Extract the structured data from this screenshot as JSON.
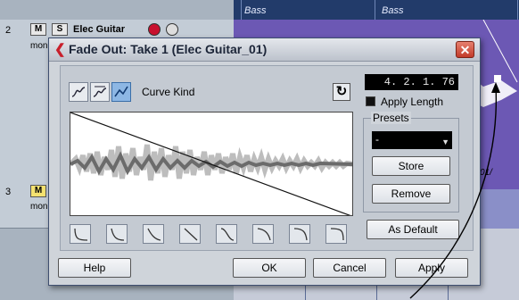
{
  "background": {
    "ruler_labels": [
      "Bass",
      "Bass"
    ],
    "tracks": [
      {
        "number": "2",
        "mute": "M",
        "solo": "S",
        "name": "Elec Guitar",
        "mode": "mon"
      },
      {
        "number": "3",
        "mute": "M",
        "mode": "mon"
      }
    ],
    "clip_time": "01/"
  },
  "dialog": {
    "title": "Fade Out: Take 1 (Elec Guitar_01)",
    "close_glyph": "✕",
    "curve_kind_label": "Curve Kind",
    "reset_glyph": "↻",
    "length_value": "4. 2. 1. 76",
    "apply_length_label": "Apply Length",
    "apply_length_checked": true,
    "presets": {
      "group_label": "Presets",
      "selected": "-",
      "store_label": "Store",
      "remove_label": "Remove"
    },
    "as_default_label": "As Default",
    "buttons": {
      "help": "Help",
      "ok": "OK",
      "cancel": "Cancel",
      "apply": "Apply"
    },
    "curve_kind_icons": [
      "spline-curve-icon",
      "damped-spline-curve-icon",
      "linear-curve-icon"
    ],
    "curve_kind_selected": 2,
    "curve_shape_icons": [
      "shape-1-icon",
      "shape-2-icon",
      "shape-3-icon",
      "shape-4-icon",
      "shape-5-icon",
      "shape-6-icon",
      "shape-7-icon",
      "shape-8-icon"
    ]
  },
  "colors": {
    "ruler": "#223b6a",
    "track_region": "#6c58b4",
    "close_button": "#c23b2a",
    "selected_curve": "#8db7e4"
  }
}
